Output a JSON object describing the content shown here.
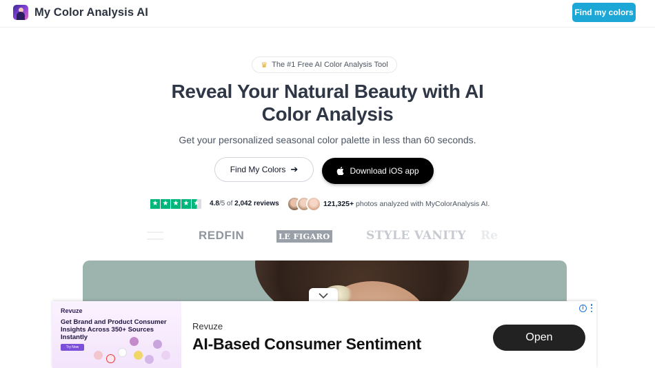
{
  "header": {
    "brand": "My Color Analysis AI",
    "cta_label": "Find my colors"
  },
  "hero": {
    "badge": "The #1 Free AI Color Analysis Tool",
    "title_line1": "Reveal Your Natural Beauty with AI",
    "title_line2": "Color Analysis",
    "subtitle": "Get your personalized seasonal color palette in less than 60 seconds.",
    "primary_cta": "Find My Colors",
    "secondary_cta": "Download iOS app"
  },
  "proof": {
    "rating_score": "4.8",
    "rating_scale": "/5 of ",
    "rating_count": "2,042 reviews",
    "stars": 4.5,
    "photos_count": "121,325+",
    "photos_text": " photos analyzed with MyColorAnalysis AI."
  },
  "press": {
    "logos": [
      "REDFIN",
      "LE FIGARO",
      "STYLE VANITY",
      "Re"
    ]
  },
  "ad": {
    "thumb_brand": "Revuze",
    "thumb_headline": "Get Brand and Product Consumer Insights Across 350+ Sources Instantly",
    "thumb_button": "Try Now",
    "advertiser": "Revuze",
    "headline": "AI-Based Consumer Sentiment",
    "cta": "Open"
  },
  "colors": {
    "accent": "#1da7d6",
    "trustpilot": "#00b67a",
    "dark": "#000000"
  },
  "icons": [
    "logo-icon",
    "crown-icon",
    "arrow-right-icon",
    "apple-icon",
    "star-icon",
    "chevron-down-icon",
    "info-icon",
    "more-vertical-icon"
  ]
}
